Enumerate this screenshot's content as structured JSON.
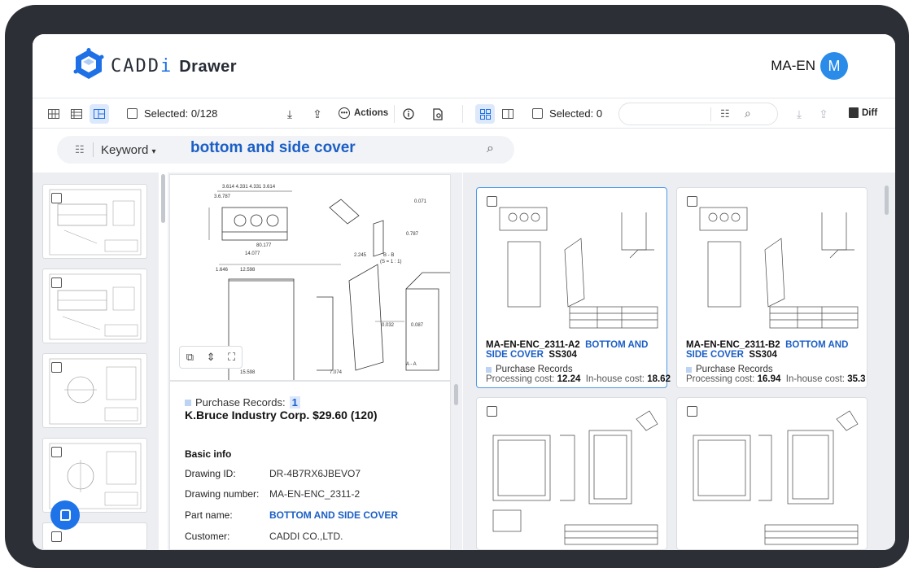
{
  "app": {
    "brand": "CADDi",
    "product": "Drawer"
  },
  "user": {
    "name": "MA-EN",
    "initial": "M",
    "avatar_color": "#2a8be8"
  },
  "toolbar": {
    "selected_left": "Selected: 0/128",
    "actions_label": "Actions",
    "selected_right": "Selected: 0",
    "diff_label": "Diff",
    "search_placeholder": ""
  },
  "search": {
    "mode": "Keyword",
    "query": "bottom and side cover"
  },
  "detail": {
    "purchase_label": "Purchase Records:",
    "purchase_count": "1",
    "supplier_line": "K.Bruce Industry Corp.  $29.60  (120)",
    "basic_info_title": "Basic info",
    "fields": [
      {
        "label": "Drawing ID:",
        "value": "DR-4B7RX6JBEVO7"
      },
      {
        "label": "Drawing number:",
        "value": "MA-EN-ENC_2311-2"
      },
      {
        "label": "Part name:",
        "value": "BOTTOM AND SIDE COVER"
      },
      {
        "label": "Customer:",
        "value": "CADDI CO.,LTD."
      }
    ]
  },
  "results": [
    {
      "code": "MA-EN-ENC_2311-A2",
      "name": "BOTTOM AND SIDE COVER",
      "material": "SS304",
      "purchase_label": "Purchase Records",
      "processing_label": "Processing cost:",
      "processing_cost": "12.24",
      "inhouse_label": "In-house cost:",
      "inhouse_cost": "18.62",
      "selected": true
    },
    {
      "code": "MA-EN-ENC_2311-B2",
      "name": "BOTTOM AND SIDE COVER",
      "material": "SS304",
      "purchase_label": "Purchase Records",
      "processing_label": "Processing cost:",
      "processing_cost": "16.94",
      "inhouse_label": "In-house cost:",
      "inhouse_cost": "35.3",
      "selected": false
    }
  ],
  "colors": {
    "accent": "#1e70e6",
    "link": "#1b5fc6",
    "selected_border": "#4a9bea",
    "bezel": "#2c2f36"
  }
}
